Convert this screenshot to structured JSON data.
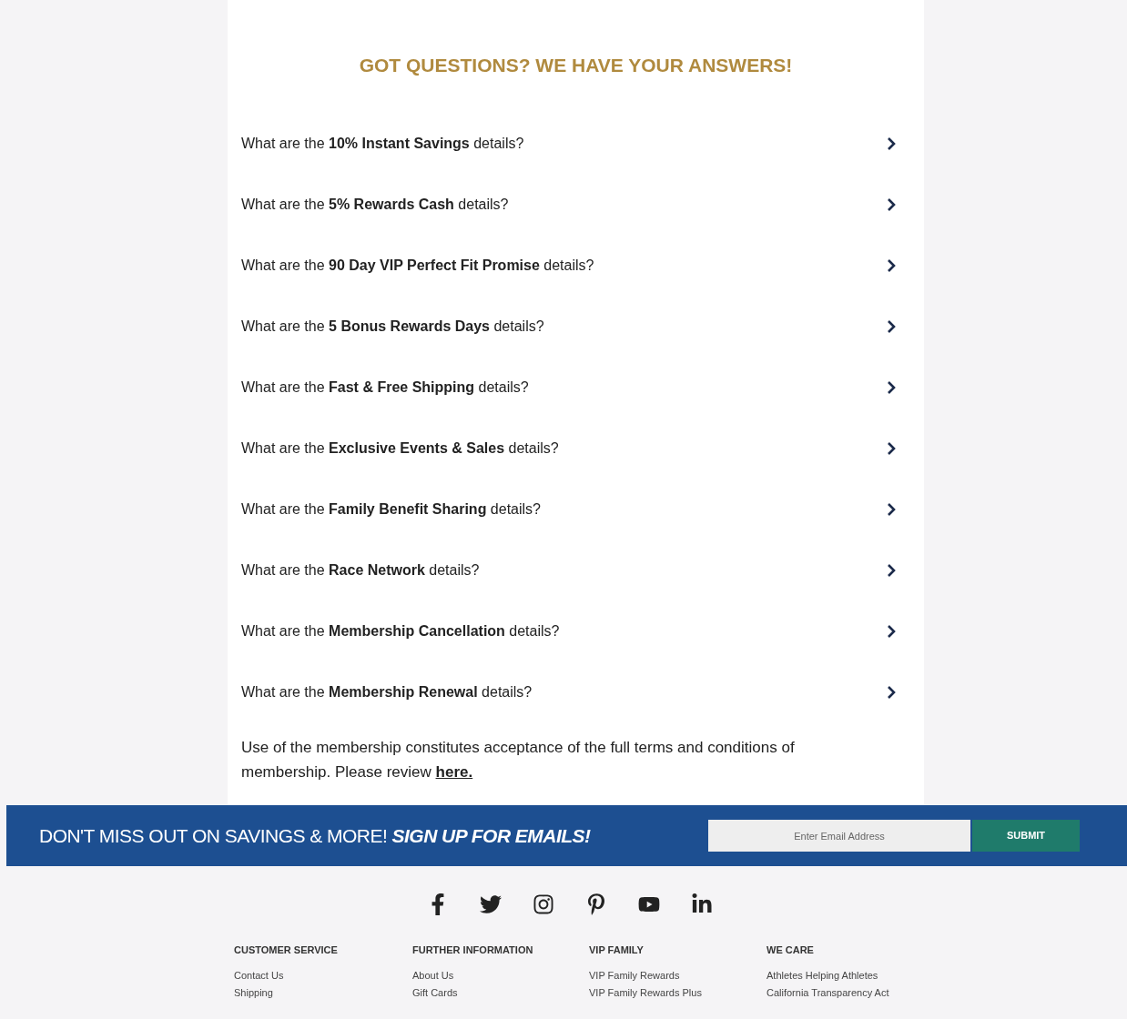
{
  "faq": {
    "title": "GOT QUESTIONS? WE HAVE YOUR ANSWERS!",
    "questions": [
      {
        "text": "What are the **10% Instant Savings** details?",
        "expanded": false
      },
      {
        "text": "What are the **5% Rewards Cash** details?",
        "expanded": false
      },
      {
        "text": "What are the **90 Day VIP Perfect Fit Promise** details?",
        "expanded": false
      },
      {
        "text": "What are the **5 Bonus Rewards Days** details?",
        "expanded": false
      },
      {
        "text": "What are the **Fast & Free Shipping** details?",
        "expanded": false
      },
      {
        "text": "What are the **Exclusive Events & Sales** details?",
        "expanded": false
      },
      {
        "text": "What are the **Family Benefit Sharing** details?",
        "expanded": false
      },
      {
        "text": "What are the **Race Network** details?",
        "expanded": false
      },
      {
        "text": "What are the **Membership Cancellation** details?",
        "expanded": false
      },
      {
        "text": "What are the **Membership Renewal** details?",
        "expanded": false
      }
    ],
    "terms": "Use of the membership constitutes acceptance of the full terms and conditions of membership. Please review",
    "terms_link": "here."
  },
  "signup": {
    "text": "DON'T MISS OUT ON SAVINGS & MORE!",
    "emphasis": "SIGN UP FOR EMAILS!",
    "email_placeholder": "Enter Email Address",
    "submit": "SUBMIT"
  },
  "footer": {
    "social": [
      {
        "kind": "facebook"
      },
      {
        "kind": "twitter"
      },
      {
        "kind": "instagram"
      },
      {
        "kind": "pinterest"
      },
      {
        "kind": "youtube"
      },
      {
        "kind": "linkedin"
      }
    ],
    "columns": [
      {
        "heading": "CUSTOMER SERVICE",
        "links": [
          "Contact Us",
          "Shipping"
        ]
      },
      {
        "heading": "FURTHER INFORMATION",
        "links": [
          "About Us",
          "Gift Cards"
        ]
      },
      {
        "heading": "VIP FAMILY",
        "links": [
          "VIP Family Rewards",
          "VIP Family Rewards Plus"
        ]
      },
      {
        "heading": "WE CARE",
        "links": [
          "Athletes Helping Athletes",
          "California Transparency Act"
        ]
      }
    ]
  }
}
